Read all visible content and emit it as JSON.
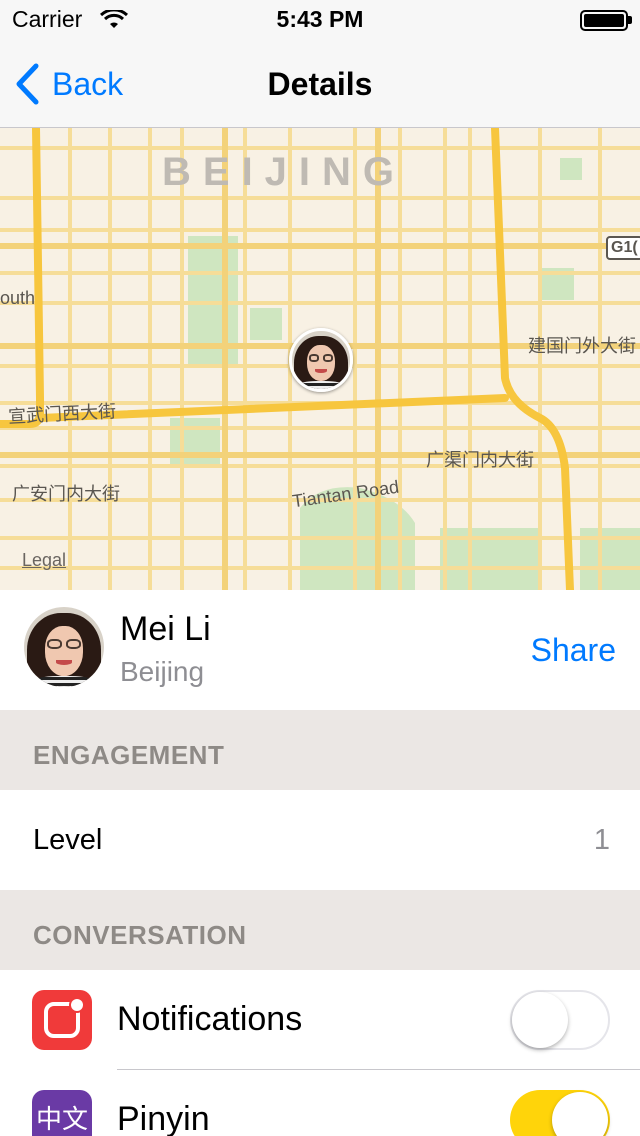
{
  "status_bar": {
    "carrier": "Carrier",
    "time": "5:43 PM"
  },
  "nav": {
    "back_label": "Back",
    "title": "Details"
  },
  "map": {
    "city": "BEIJING",
    "labels": {
      "south": "outh",
      "xuanwu": "宣武门西大街",
      "guanganmen": "广安门内大街",
      "tiantan": "Tiantan Road",
      "jianguomen": "建国门外大街",
      "guangqumen": "广渠门内大街",
      "g1": "G1("
    },
    "legal": "Legal"
  },
  "profile": {
    "name": "Mei Li",
    "city": "Beijing",
    "share_label": "Share"
  },
  "sections": {
    "engagement": {
      "header": "ENGAGEMENT",
      "rows": [
        {
          "label": "Level",
          "value": "1"
        }
      ]
    },
    "conversation": {
      "header": "CONVERSATION",
      "rows": [
        {
          "label": "Notifications",
          "icon": "notifications-icon",
          "icon_color": "#f03a3a",
          "toggle": false
        },
        {
          "label": "Pinyin",
          "icon": "pinyin-icon",
          "icon_glyph": "中文",
          "icon_color": "#6a3aa5",
          "toggle": true
        }
      ]
    }
  },
  "colors": {
    "accent": "#007aff",
    "toggle_on": "#ffd40a",
    "map_bg": "#f8f1e4",
    "park": "#cfe6c0",
    "road_major": "#f7c63e",
    "road_minor": "#f6dd98"
  }
}
